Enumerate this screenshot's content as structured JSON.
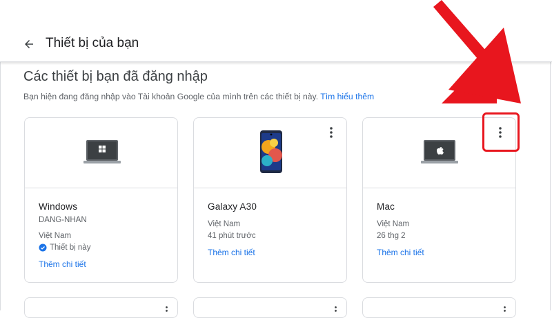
{
  "header": {
    "title": "Thiết bị của bạn",
    "back_icon": "arrow-back-icon"
  },
  "section": {
    "title": "Các thiết bị bạn đã đăng nhập",
    "description": "Bạn hiện đang đăng nhập vào Tài khoản Google của mình trên các thiết bị này.",
    "learn_more": "Tìm hiểu thêm"
  },
  "devices": [
    {
      "name": "Windows",
      "detail1": "DANG-NHAN",
      "detail2": "Việt Nam",
      "detail3": "Thiết bị này",
      "link": "Thêm chi tiết",
      "icon": "windows-laptop-icon"
    },
    {
      "name": "Galaxy A30",
      "detail1": "Việt Nam",
      "detail2": "41 phút trước",
      "link": "Thêm chi tiết",
      "icon": "android-phone-icon"
    },
    {
      "name": "Mac",
      "detail1": "Việt Nam",
      "detail2": "26 thg 2",
      "link": "Thêm chi tiết",
      "icon": "mac-laptop-icon"
    }
  ],
  "colors": {
    "accent": "#1a73e8",
    "highlight": "#e8161e",
    "check": "#1a73e8"
  }
}
